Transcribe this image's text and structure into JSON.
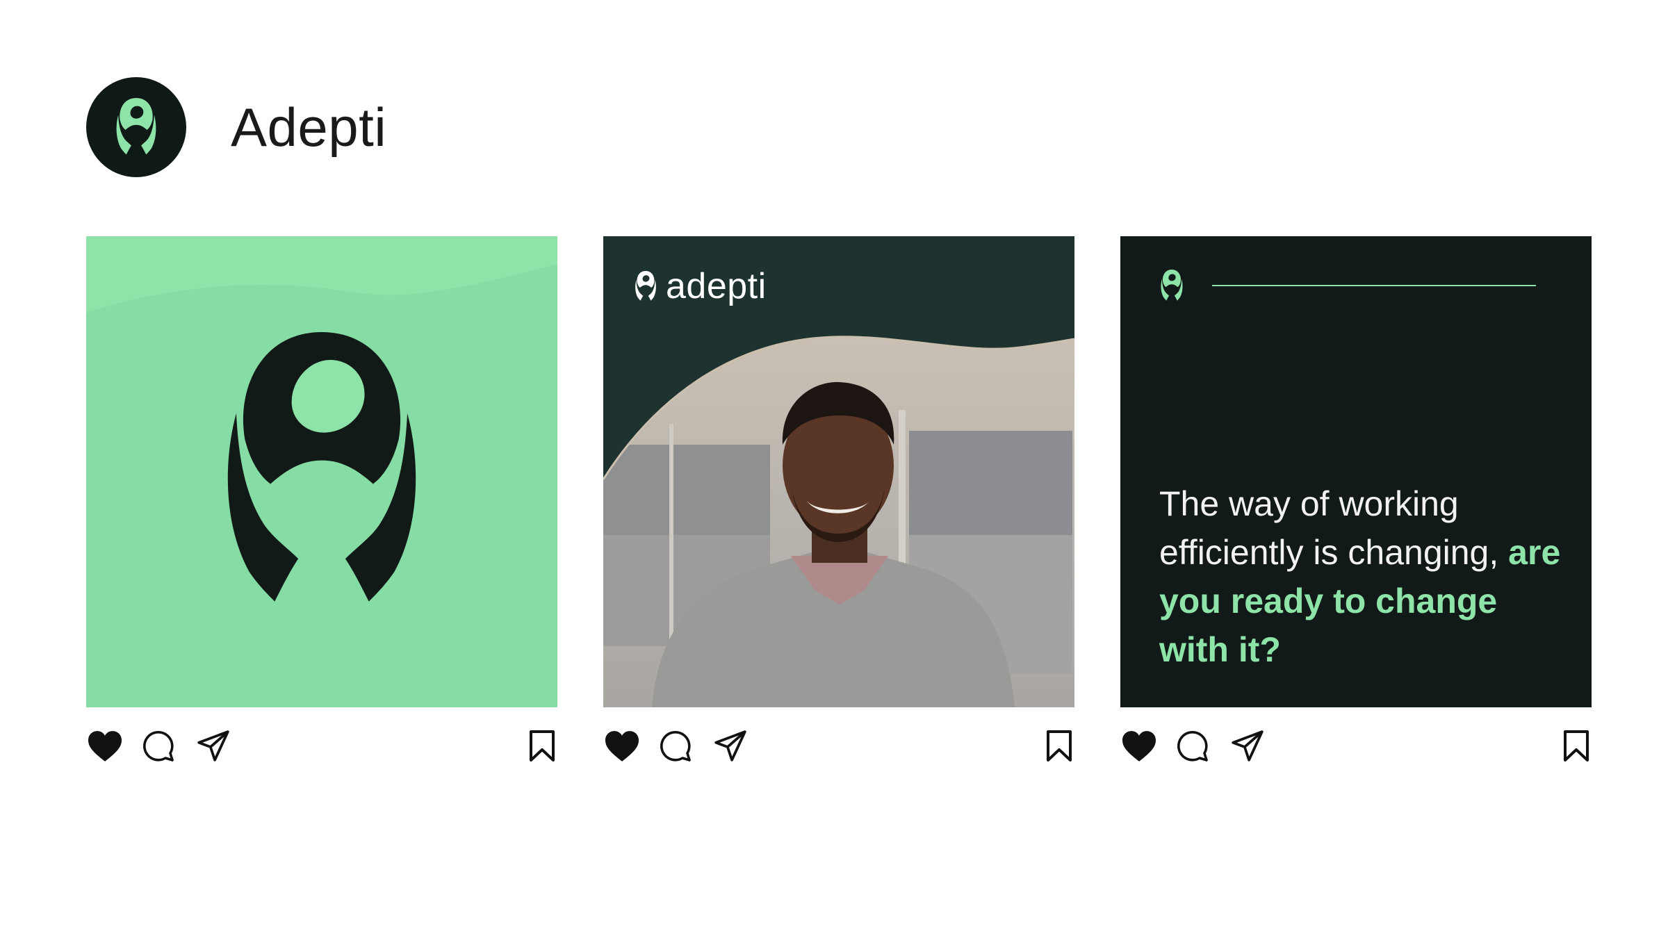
{
  "profile": {
    "name": "Adepti",
    "avatar_icon": "adepti-logo-icon"
  },
  "colors": {
    "brand_green": "#8ee3a8",
    "brand_dark": "#0f1a17",
    "photo_bg": "#1e3230"
  },
  "posts": [
    {
      "type": "logo-tile",
      "actions": [
        "heart-icon",
        "comment-icon",
        "share-icon",
        "bookmark-icon"
      ]
    },
    {
      "type": "photo-tile",
      "wordmark": "adepti",
      "actions": [
        "heart-icon",
        "comment-icon",
        "share-icon",
        "bookmark-icon"
      ]
    },
    {
      "type": "quote-tile",
      "quote_regular": "The way of working efficiently is changing,",
      "quote_highlight": "are you ready to change with it?",
      "actions": [
        "heart-icon",
        "comment-icon",
        "share-icon",
        "bookmark-icon"
      ]
    }
  ]
}
